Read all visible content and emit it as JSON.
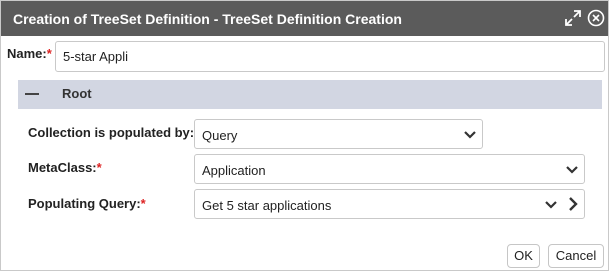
{
  "window": {
    "title": "Creation of TreeSet Definition - TreeSet Definition Creation",
    "icons": {
      "expand": "expand-icon",
      "close": "close-circle-icon"
    }
  },
  "form": {
    "name_label": "Name:",
    "required_marker": "*",
    "name_value": "5-star Appli"
  },
  "section": {
    "title": "Root",
    "collapse_icon": "minus-icon"
  },
  "fields": {
    "collection_label": "Collection is populated by:",
    "collection_value": "Query",
    "metaclass_label": "MetaClass:",
    "metaclass_value": "Application",
    "query_label": "Populating Query:",
    "query_value": "Get 5 star applications"
  },
  "buttons": {
    "ok": "OK",
    "cancel": "Cancel"
  },
  "colors": {
    "titlebar": "#5b5b5b",
    "section_header": "#d2d6e2",
    "required": "#dd2222"
  }
}
